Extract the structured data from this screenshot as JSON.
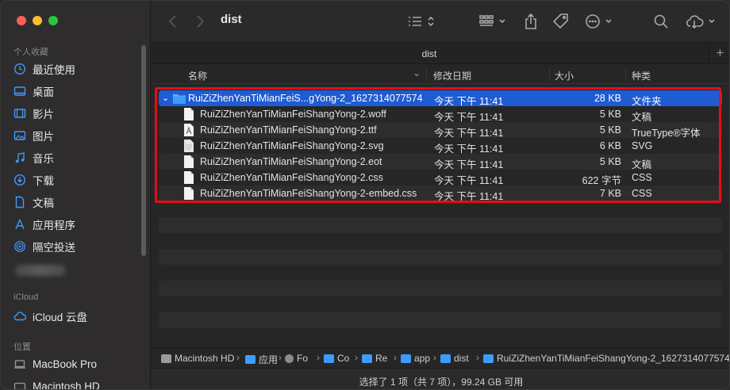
{
  "window": {
    "title": "dist"
  },
  "sidebar": {
    "favorites_header": "个人收藏",
    "favorites": [
      {
        "label": "最近使用",
        "icon": "clock-icon"
      },
      {
        "label": "桌面",
        "icon": "desktop-icon"
      },
      {
        "label": "影片",
        "icon": "film-icon"
      },
      {
        "label": "图片",
        "icon": "photo-icon"
      },
      {
        "label": "音乐",
        "icon": "music-icon"
      },
      {
        "label": "下载",
        "icon": "download-icon"
      },
      {
        "label": "文稿",
        "icon": "document-icon"
      },
      {
        "label": "应用程序",
        "icon": "apps-icon"
      },
      {
        "label": "隔空投送",
        "icon": "airdrop-icon"
      }
    ],
    "icloud_header": "iCloud",
    "icloud_drive": "iCloud 云盘",
    "locations_header": "位置",
    "locations": [
      {
        "label": "MacBook Pro",
        "icon": "laptop-icon"
      },
      {
        "label": "Macintosh HD",
        "icon": "disk-icon"
      }
    ]
  },
  "toolbar": {
    "title": "dist"
  },
  "tabbar": {
    "label": "dist",
    "plus": "+"
  },
  "columns": {
    "name": "名称",
    "date": "修改日期",
    "size": "大小",
    "kind": "种类"
  },
  "rows": [
    {
      "name": "RuiZiZhenYanTiMianFeiS...gYong-2_1627314077574",
      "date": "今天 下午 11:41",
      "size": "28 KB",
      "kind": "文件夹",
      "type": "folder"
    },
    {
      "name": "RuiZiZhenYanTiMianFeiShangYong-2.woff",
      "date": "今天 下午 11:41",
      "size": "5 KB",
      "kind": "文稿",
      "type": "file"
    },
    {
      "name": "RuiZiZhenYanTiMianFeiShangYong-2.ttf",
      "date": "今天 下午 11:41",
      "size": "5 KB",
      "kind": "TrueType®字体",
      "type": "font"
    },
    {
      "name": "RuiZiZhenYanTiMianFeiShangYong-2.svg",
      "date": "今天 下午 11:41",
      "size": "6 KB",
      "kind": "SVG",
      "type": "file"
    },
    {
      "name": "RuiZiZhenYanTiMianFeiShangYong-2.eot",
      "date": "今天 下午 11:41",
      "size": "5 KB",
      "kind": "文稿",
      "type": "file"
    },
    {
      "name": "RuiZiZhenYanTiMianFeiShangYong-2.css",
      "date": "今天 下午 11:41",
      "size": "622 字节",
      "kind": "CSS",
      "type": "file"
    },
    {
      "name": "RuiZiZhenYanTiMianFeiShangYong-2-embed.css",
      "date": "今天 下午 11:41",
      "size": "7 KB",
      "kind": "CSS",
      "type": "file"
    }
  ],
  "pathbar": {
    "crumbs": [
      "Macintosh HD",
      "应用",
      "Fo",
      "Co",
      "Re",
      "app",
      "dist",
      "RuiZiZhenYanTiMianFeiShangYong-2_1627314077574"
    ],
    "separator": "›"
  },
  "status": {
    "text": "选择了 1 项（共 7 项），99.24 GB 可用"
  },
  "colors": {
    "accent": "#3e9bff",
    "selection": "#1f5bd2",
    "highlight_box": "#e0101a"
  }
}
